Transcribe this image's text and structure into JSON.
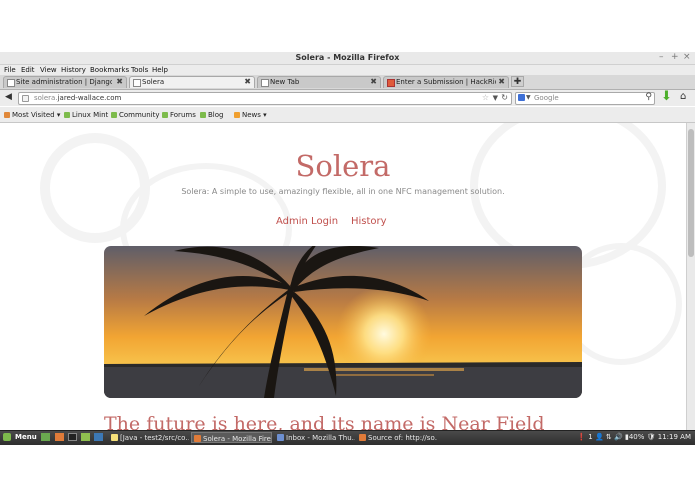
{
  "window": {
    "title": "Solera - Mozilla Firefox",
    "controls": [
      "–",
      "+",
      "×"
    ]
  },
  "menu": [
    "File",
    "Edit",
    "View",
    "History",
    "Bookmarks",
    "Tools",
    "Help"
  ],
  "tabs": [
    {
      "label": "Site administration | Django sit…",
      "active": false
    },
    {
      "label": "Solera",
      "active": true
    },
    {
      "label": "New Tab",
      "active": false
    },
    {
      "label": "Enter a Submission | HackRice …",
      "active": false
    }
  ],
  "nav": {
    "url_prefix": "solera.",
    "url_domain": "jared-wallace.com",
    "search_placeholder": "Google"
  },
  "bookmarks": [
    {
      "label": "Most Visited ▾",
      "color": "#e0883a"
    },
    {
      "label": "Linux Mint",
      "color": "#7dbb4c"
    },
    {
      "label": "Community",
      "color": "#7dbb4c"
    },
    {
      "label": "Forums",
      "color": "#7dbb4c"
    },
    {
      "label": "Blog",
      "color": "#7dbb4c"
    },
    {
      "label": "News ▾",
      "color": "#f0a030"
    }
  ],
  "page": {
    "title": "Solera",
    "tagline": "Solera: A simple to use, amazingly flexible, all in one NFC management solution.",
    "nav_links": [
      "Admin Login",
      "History"
    ],
    "heading": "The future is here, and its name is Near Field"
  },
  "taskbar": {
    "menu_label": "Menu",
    "tasks": [
      {
        "label": "[Java - test2/src/co…",
        "active": false
      },
      {
        "label": "Solera - Mozilla Firef…",
        "active": true
      },
      {
        "label": "Inbox - Mozilla Thu…",
        "active": false
      },
      {
        "label": "Source of: http://so…",
        "active": false
      }
    ],
    "tray": {
      "badge": "1",
      "battery": "40%",
      "clock": "11:19 AM"
    }
  },
  "colors": {
    "accent": "#c36a67",
    "link": "#c0504d"
  }
}
